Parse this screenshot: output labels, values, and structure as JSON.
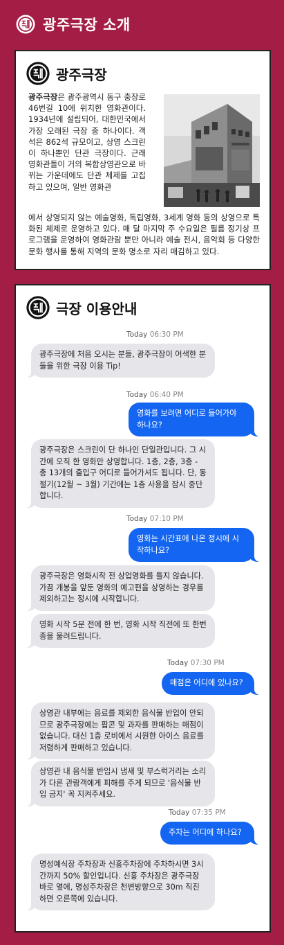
{
  "header": {
    "title": "광주극장 소개",
    "logo_icon": "theater-emblem-icon"
  },
  "intro": {
    "title": "광주극장",
    "text_lead": "광주극장",
    "text_body": "은 광주광역시 동구 충장로46번길 10에 위치한 영화관이다. 1934년에 설립되어, 대한민국에서 가장 오래된 극장 중 하나이다. 객석은 862석 규모이고, 상영 스크린이 하나뿐인 단관 극장이다. 근래 영화관들이 거의 복합상영관으로 바뀌는 가운데에도 단관 체제를 고집하고 있으며, 일반 영화관",
    "text_continued": "에서 상영되지 않는 예술영화, 독립영화, 3세계 영화 등의 상영으로 특화된 체제로 운영하고 있다. 매 달 마지막 주 수요일은 필름 정기상 프로그램을 운영하여 영화관람 뿐만 아니라 예술 전시, 음악회 등 다양한 문화 행사를 통해 지역의 문화 명소로 자리 매김하고 있다."
  },
  "guide": {
    "title": "극장 이용안내",
    "messages": [
      {
        "kind": "ts",
        "day": "Today",
        "time": "06:30 PM"
      },
      {
        "kind": "in",
        "text": "광주극장에 처음 오시는 분들, 광주극장이 어색한 분들을 위한 극장 이용 Tip!"
      },
      {
        "kind": "ts",
        "day": "Today",
        "time": "06:40 PM"
      },
      {
        "kind": "out",
        "text": "영화를 보려면 어디로 들어가야 하나요?"
      },
      {
        "kind": "in",
        "text": "광주극장은 스크린이 단 하나인 단일관입니다. 그 시간에 오직 한 영화만 상영합니다. 1층, 2층, 3층 - 총 13개의 출입구 어디로 들어가셔도 됩니다. 단, 동절기(12월 ~ 3월) 기간에는 1층 사용을 잠시 중단합니다."
      },
      {
        "kind": "ts",
        "day": "Today",
        "time": "07:10 PM"
      },
      {
        "kind": "out",
        "text": "영화는 시간표에 나온 정시에 시작하나요?"
      },
      {
        "kind": "in",
        "text": "광주극장은 영화시작 전 상업영화를 틀지 않습니다. 가끔 개봉을 앞둔 영화의 예고편을 상영하는 경우를 제외하고는 정시에 시작합니다."
      },
      {
        "kind": "in",
        "text": "영화 시작 5분 전에 한 번, 영화 시작 직전에 또 한번 종을 울려드립니다."
      },
      {
        "kind": "ts",
        "day": "Today",
        "time": "07:30 PM"
      },
      {
        "kind": "out",
        "text": "매점은 어디에 있나요?"
      },
      {
        "kind": "in",
        "text": "상영관 내부에는 음료를 제외한 음식물 반입이 안되므로 광주극장에는 팝콘 및 과자를 판매하는 매점이 없습니다. 대신 1층 로비에서 시원한 아이스 음료를 저렴하게 판매하고 있습니다."
      },
      {
        "kind": "in",
        "text": "상영관 내 음식물 반입시 냄새 및 부스럭거리는 소리가 다른 관람객에게 피해를 주게 되므로 '음식물 반입 금지' 꼭 지켜주세요."
      },
      {
        "kind": "ts",
        "day": "Today",
        "time": "07:35 PM"
      },
      {
        "kind": "out",
        "text": "주차는 어디에 하나요?"
      },
      {
        "kind": "in",
        "text": "명성예식장 주차장과 신흥주차장에 주차하시면 3시간까지 50% 할인입니다. 신흥 주차장은 광주극장 바로 옆에, 명성주차장은 천변방향으로 30m 직진하면 오른쪽에 있습니다."
      }
    ]
  },
  "colors": {
    "background": "#a31d45",
    "incoming": "#e5e5ea",
    "outgoing": "#1466f2"
  }
}
